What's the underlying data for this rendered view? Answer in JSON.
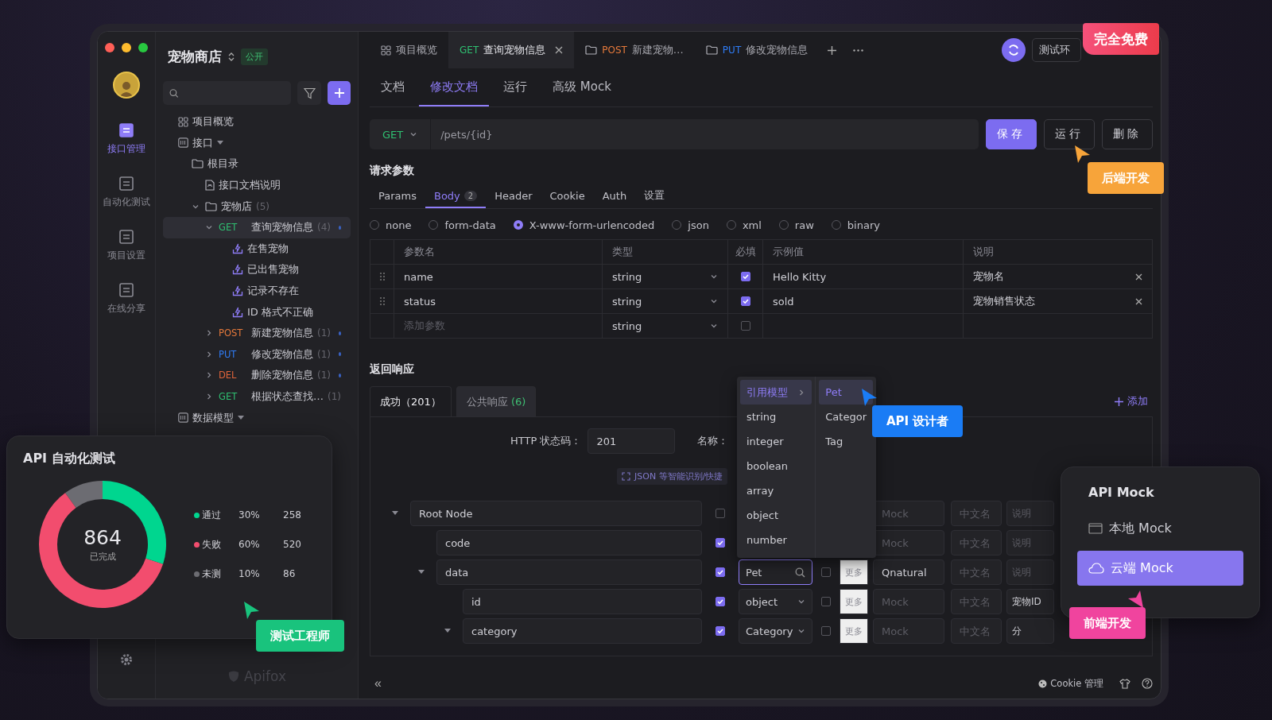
{
  "rail": {
    "items": [
      {
        "label": "接口管理",
        "selected": true
      },
      {
        "label": "自动化测试",
        "selected": false
      },
      {
        "label": "项目设置",
        "selected": false
      },
      {
        "label": "在线分享",
        "selected": false
      }
    ]
  },
  "project": {
    "name": "宠物商店",
    "visibility": "公开"
  },
  "sidebar": {
    "items": [
      {
        "kind": "overview",
        "label": "项目概览",
        "selected": false
      },
      {
        "kind": "section",
        "label": "接口",
        "selected": false,
        "children": [
          {
            "kind": "folder",
            "label": "根目录",
            "selected": false,
            "children": [
              {
                "kind": "doc",
                "label": "接口文档说明",
                "selected": false
              },
              {
                "kind": "folder",
                "label": "宠物店",
                "count": "(5)",
                "expanded": true,
                "selected": false,
                "children": [
                  {
                    "kind": "endpoint",
                    "method": "GET",
                    "color": "#2fbf71",
                    "label": "查询宠物信息",
                    "count": "(4)",
                    "expanded": true,
                    "selected": true,
                    "children": [
                      {
                        "kind": "case",
                        "label": "在售宠物",
                        "selected": false
                      },
                      {
                        "kind": "case",
                        "label": "已出售宠物",
                        "selected": false
                      },
                      {
                        "kind": "case",
                        "label": "记录不存在",
                        "selected": false
                      },
                      {
                        "kind": "case",
                        "label": "ID 格式不正确",
                        "selected": false
                      }
                    ]
                  },
                  {
                    "kind": "endpoint",
                    "method": "POST",
                    "color": "#e5793b",
                    "label": "新建宠物信息",
                    "count": "(1)",
                    "expanded": false,
                    "selected": false
                  },
                  {
                    "kind": "endpoint",
                    "method": "PUT",
                    "color": "#2f7cf6",
                    "label": "修改宠物信息",
                    "count": "(1)",
                    "expanded": false,
                    "selected": false
                  },
                  {
                    "kind": "endpoint",
                    "method": "DEL",
                    "color": "#e0643a",
                    "label": "删除宠物信息",
                    "count": "(1)",
                    "expanded": false,
                    "selected": false
                  },
                  {
                    "kind": "endpoint",
                    "method": "GET",
                    "color": "#2fbf71",
                    "label": "根据状态查找…",
                    "count": "(1)",
                    "expanded": false,
                    "selected": false
                  }
                ]
              }
            ]
          }
        ]
      },
      {
        "kind": "section",
        "label": "数据模型",
        "selected": false
      }
    ]
  },
  "brand": "Apifox",
  "tabs": [
    {
      "kind": "overview",
      "label": "项目概览",
      "selected": false
    },
    {
      "kind": "endpoint",
      "method": "GET",
      "color": "#2fbf71",
      "label": "查询宠物信息",
      "selected": true
    },
    {
      "kind": "folder",
      "method": "POST",
      "color": "#e5793b",
      "label": "新建宠物…",
      "selected": false
    },
    {
      "kind": "folder",
      "method": "PUT",
      "color": "#2f7cf6",
      "label": "修改宠物信息",
      "selected": false
    }
  ],
  "environment": {
    "value": "测试环"
  },
  "doc_tabs": [
    {
      "label": "文档",
      "selected": false
    },
    {
      "label": "修改文档",
      "selected": true
    },
    {
      "label": "运行",
      "selected": false
    },
    {
      "label": "高级 Mock",
      "selected": false
    }
  ],
  "request": {
    "method": "GET",
    "url": "/pets/{id}",
    "buttons": [
      {
        "label": "保存",
        "kind": "primary"
      },
      {
        "label": "运行",
        "kind": "secondary"
      },
      {
        "label": "删除",
        "kind": "secondary"
      }
    ]
  },
  "params": {
    "title": "请求参数",
    "tabs": [
      {
        "label": "Params",
        "selected": false
      },
      {
        "label": "Body",
        "count": "2",
        "selected": true
      },
      {
        "label": "Header",
        "selected": false
      },
      {
        "label": "Cookie",
        "selected": false
      },
      {
        "label": "Auth",
        "selected": false
      },
      {
        "label": "设置",
        "selected": false
      }
    ],
    "body_types": [
      {
        "label": "none",
        "selected": false
      },
      {
        "label": "form-data",
        "selected": false
      },
      {
        "label": "X-www-form-urlencoded",
        "selected": true
      },
      {
        "label": "json",
        "selected": false
      },
      {
        "label": "xml",
        "selected": false
      },
      {
        "label": "raw",
        "selected": false
      },
      {
        "label": "binary",
        "selected": false
      }
    ],
    "table": {
      "columns": [
        "参数名",
        "类型",
        "必填",
        "示例值",
        "说明"
      ],
      "rows": [
        {
          "name": "name",
          "type": "string",
          "required": true,
          "example": "Hello Kitty",
          "description": "宠物名"
        },
        {
          "name": "status",
          "type": "string",
          "required": true,
          "example": "sold",
          "description": "宠物销售状态"
        }
      ],
      "new_row": {
        "placeholder": "添加参数",
        "type": "string",
        "required": false
      }
    }
  },
  "response": {
    "title": "返回响应",
    "tabs": [
      {
        "label": "成功（201）",
        "selected": true
      },
      {
        "label": "公共响应",
        "count": "(6)",
        "selected": false
      }
    ],
    "add_label": "添加",
    "status_label": "HTTP 状态码：",
    "status_value": "201",
    "name_label": "名称：",
    "hint": "JSON 等智能识别/快捷",
    "schema": [
      {
        "name": "Root Node",
        "kind": "plain",
        "required": false,
        "expanded": true,
        "mock_placeholder": "Mock",
        "cn_placeholder": "中文名",
        "desc_placeholder": "说明",
        "children": [
          {
            "name": "code",
            "kind": "plain",
            "required": true,
            "mock_placeholder": "Mock",
            "cn_placeholder": "中文名",
            "desc_placeholder": "说明"
          },
          {
            "name": "data",
            "kind": "search",
            "required": true,
            "expanded": true,
            "type": "Pet",
            "nullable": false,
            "more": "更多",
            "mock": "Qnatural",
            "cn_placeholder": "中文名",
            "desc_placeholder": "说明",
            "children": [
              {
                "name": "id",
                "kind": "select",
                "required": true,
                "type": "object",
                "nullable": false,
                "more": "更多",
                "mock_placeholder": "Mock",
                "cn_placeholder": "中文名",
                "description": "宠物ID"
              },
              {
                "name": "category",
                "kind": "select",
                "required": true,
                "expanded": true,
                "type": "Category",
                "nullable": false,
                "more": "更多",
                "mock_placeholder": "Mock",
                "cn_placeholder": "中文名",
                "description": "分"
              }
            ]
          }
        ]
      }
    ]
  },
  "type_menu": {
    "types": [
      {
        "label": "引用模型",
        "kind": "submenu",
        "selected": true
      },
      {
        "label": "string",
        "kind": "item",
        "selected": false
      },
      {
        "label": "integer",
        "kind": "item",
        "selected": false
      },
      {
        "label": "boolean",
        "kind": "item",
        "selected": false
      },
      {
        "label": "array",
        "kind": "item",
        "selected": false
      },
      {
        "label": "object",
        "kind": "item",
        "selected": false
      },
      {
        "label": "number",
        "kind": "item",
        "selected": false
      }
    ],
    "models": [
      {
        "label": "Pet",
        "selected": true
      },
      {
        "label": "Categor",
        "selected": false
      },
      {
        "label": "Tag",
        "selected": false
      }
    ]
  },
  "footer": {
    "collapse": "«",
    "cookie_label": "Cookie 管理"
  },
  "promo_badge": "完全免费",
  "roles": [
    {
      "label": "后端开发",
      "color": "#f7a43a"
    },
    {
      "label": "API 设计者",
      "color": "#1a7cf5"
    },
    {
      "label": "测试工程师",
      "color": "#19c37d"
    },
    {
      "label": "前端开发",
      "color": "#f0449e"
    }
  ],
  "test_card": {
    "title": "API 自动化测试",
    "total": "864",
    "total_label": "已完成",
    "legend": [
      {
        "percent": "30%",
        "count": "258",
        "color": "#00d68f"
      },
      {
        "percent": "60%",
        "count": "520",
        "color": "#f24d6e"
      },
      {
        "percent": "10%",
        "count": "86",
        "color": "#6c6c72"
      }
    ],
    "chart_data": {
      "type": "donut",
      "categories": [
        "通过",
        "失败",
        "未测"
      ],
      "values": [
        30,
        60,
        10
      ]
    }
  },
  "mock_card": {
    "title": "API Mock",
    "items": [
      {
        "label": "本地 Mock",
        "selected": false
      },
      {
        "label": "云端 Mock",
        "selected": true
      }
    ]
  }
}
